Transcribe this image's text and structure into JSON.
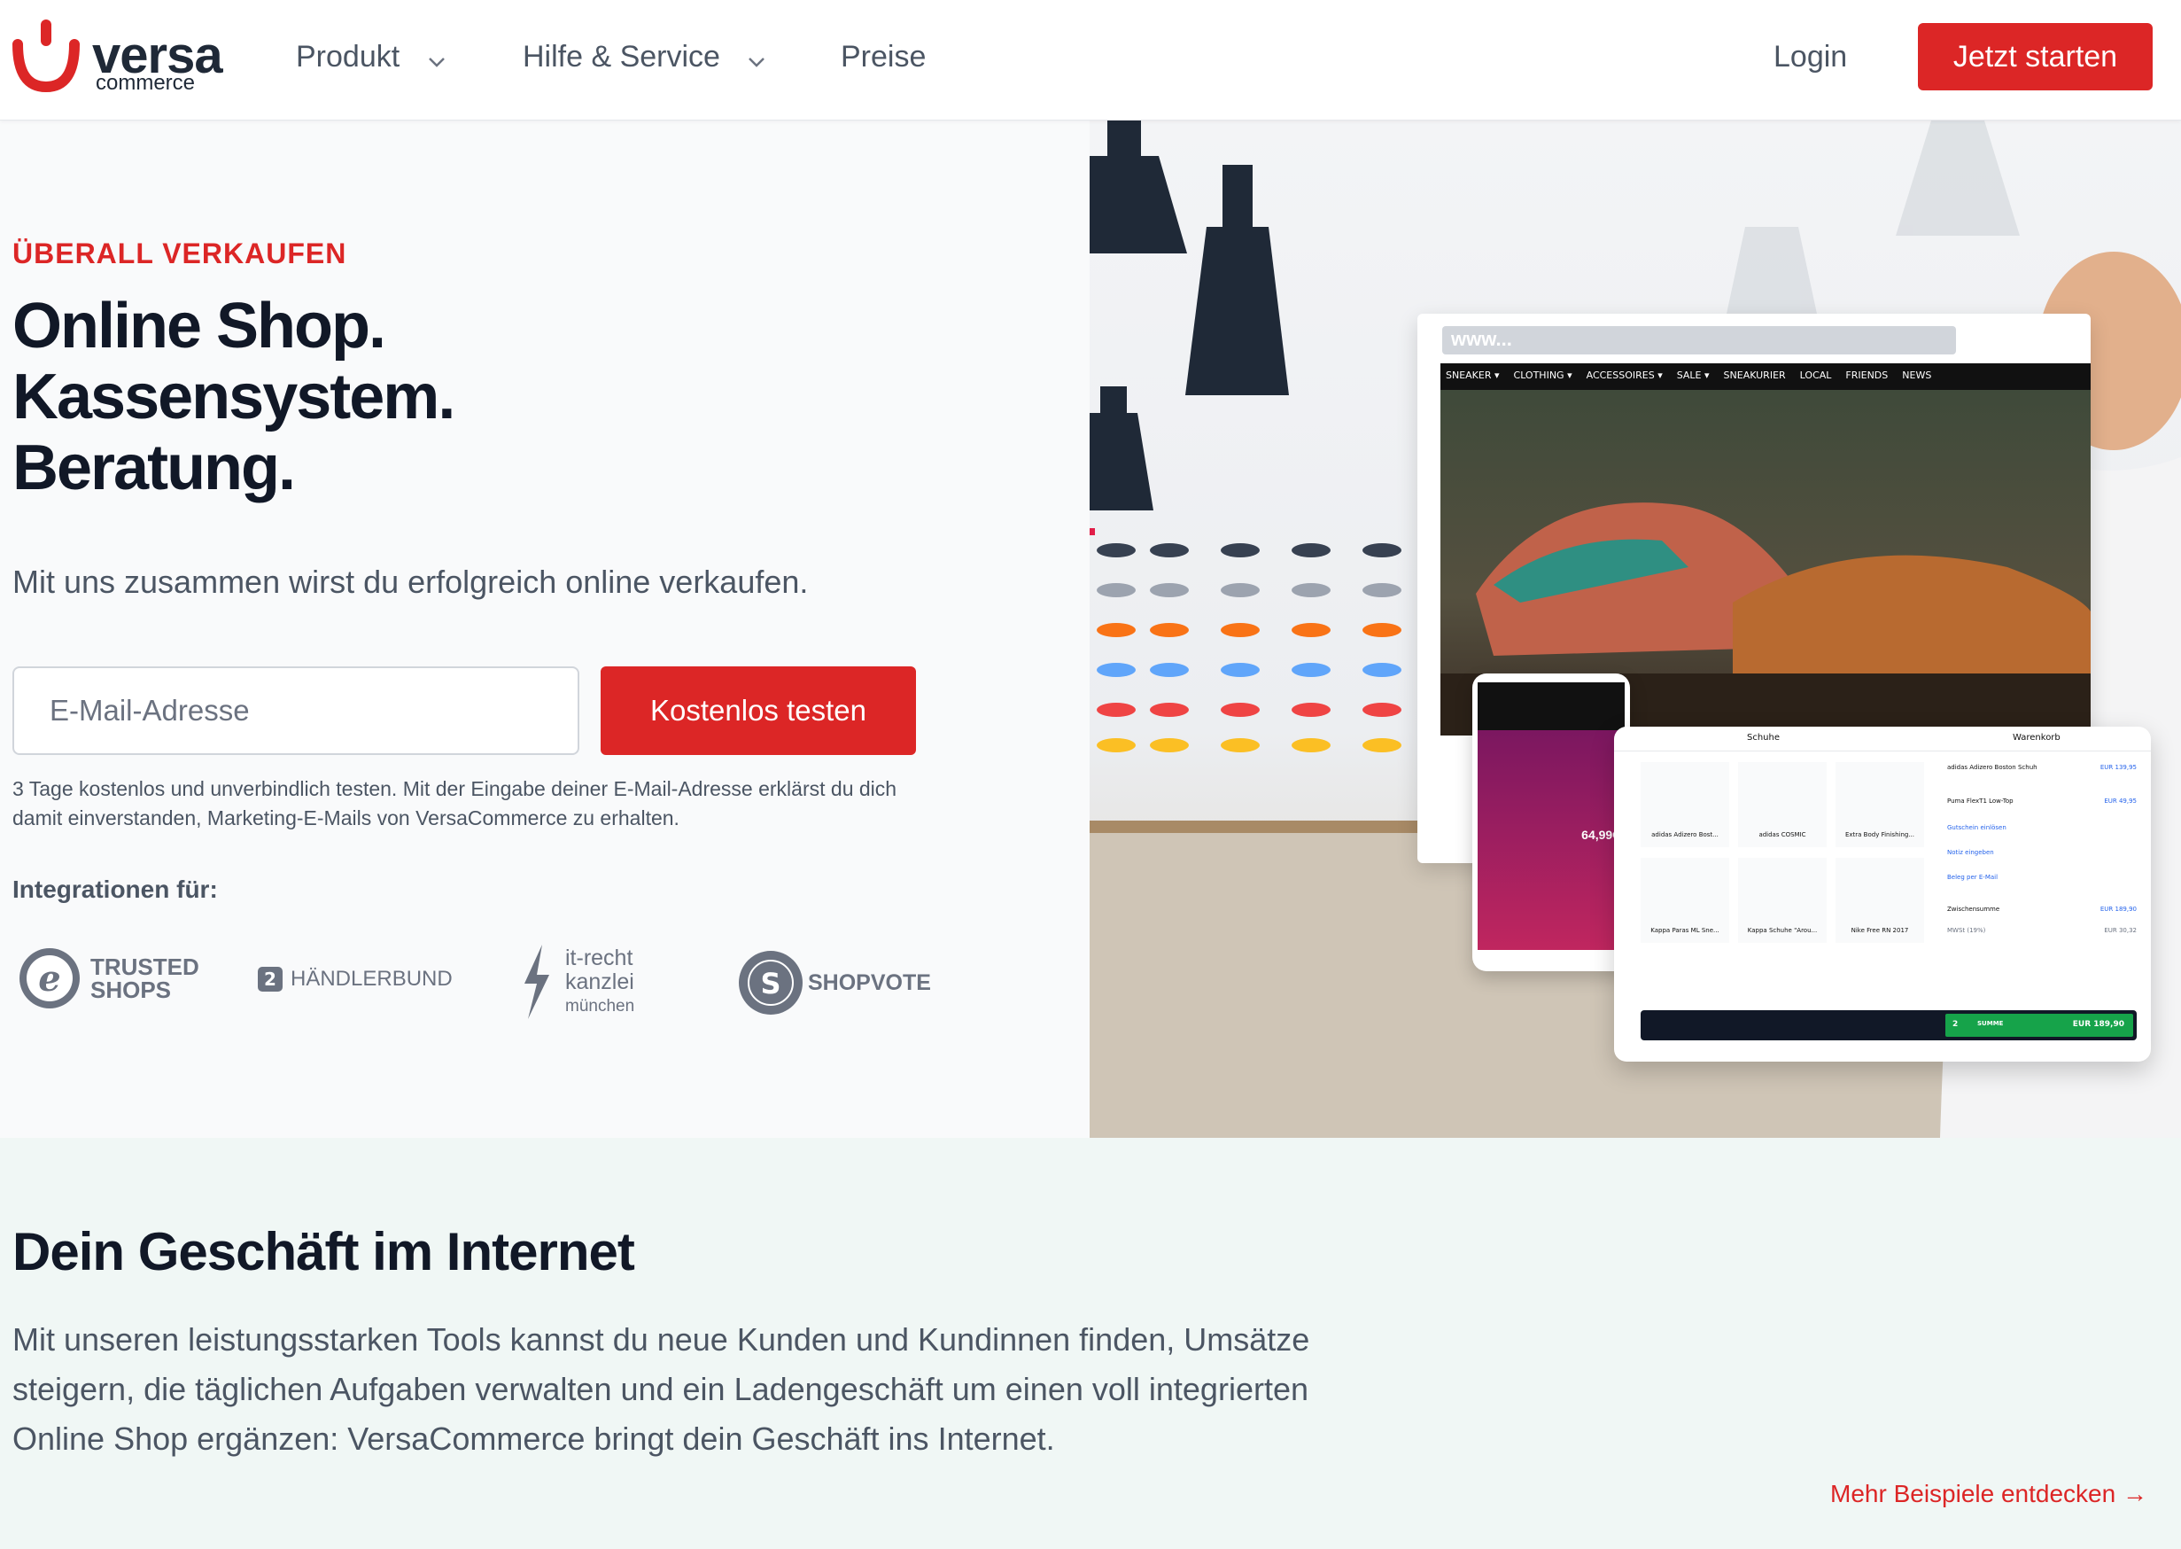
{
  "header": {
    "logo_word": "versa",
    "logo_sub": "commerce",
    "nav": [
      {
        "label": "Produkt",
        "dropdown": true
      },
      {
        "label": "Hilfe & Service",
        "dropdown": true
      },
      {
        "label": "Preise",
        "dropdown": false
      }
    ],
    "login_label": "Login",
    "cta_label": "Jetzt starten"
  },
  "hero": {
    "eyebrow": "ÜBERALL VERKAUFEN",
    "headline_lines": [
      "Online Shop.",
      "Kassensystem.",
      "Beratung."
    ],
    "subline": "Mit uns zusammen wirst du erfolgreich online verkaufen.",
    "email_placeholder": "E-Mail-Adresse",
    "cta_label": "Kostenlos testen",
    "disclaimer": "3 Tage kostenlos und unverbindlich testen. Mit der Eingabe deiner E-Mail-Adresse erklärst du dich damit einverstanden, Marketing-E-Mails von VersaCommerce zu erhalten.",
    "integrations_label": "Integrationen für:",
    "partners": [
      {
        "name": "TRUSTED SHOPS",
        "line1": "TRUSTED",
        "line2": "SHOPS",
        "icon": "trusted-shops-icon"
      },
      {
        "name": "HÄNDLERBUND",
        "icon": "haendlerbund-icon"
      },
      {
        "name": "it-recht kanzlei münchen",
        "line1": "it-recht",
        "line2": "kanzlei",
        "line3": "münchen",
        "icon": "lightning-icon"
      },
      {
        "name": "SHOPVOTE",
        "icon": "shopvote-icon"
      }
    ]
  },
  "mockup": {
    "browser_url": "www...",
    "shop_nav": [
      "SNEAKER ▾",
      "CLOTHING ▾",
      "ACCESSOIRES ▾",
      "SALE ▾",
      "SNEAKURIER",
      "LOCAL",
      "FRIENDS",
      "NEWS"
    ],
    "phone_price": "64,99€",
    "pos_category": "Schuhe",
    "pos_cart_title": "Warenkorb",
    "pos_products": [
      "adidas Adizero Bost...",
      "adidas COSMIC",
      "Extra Body Finishing...",
      "Kappa Paras ML Sne...",
      "Kappa Schuhe \"Arou...",
      "Nike Free RN 2017"
    ],
    "cart_items": [
      {
        "name": "adidas Adizero Boston Schuh",
        "price": "EUR 139,95"
      },
      {
        "name": "Puma FlexT1 Low-Top",
        "price": "EUR 49,95"
      }
    ],
    "cart_links": [
      "Gutschein einlösen",
      "Notiz eingeben",
      "Beleg per E-Mail"
    ],
    "subtotal_label": "Zwischensumme",
    "subtotal_value": "EUR 189,90",
    "tax_label": "MWSt (19%)",
    "tax_value": "EUR 30,32",
    "footer_count": "2",
    "footer_sum_label": "SUMME",
    "footer_sum_value": "EUR 189,90",
    "colors": {
      "pos_green": "#16a34a",
      "pos_dark": "#111827"
    }
  },
  "section2": {
    "title": "Dein Geschäft im Internet",
    "text": "Mit unseren leistungsstarken Tools kannst du neue Kunden und Kundinnen finden, Umsätze steigern, die täglichen Aufgaben verwalten und ein Ladengeschäft um einen voll integrierten Online Shop ergänzen: VersaCommerce bringt dein Geschäft ins Internet.",
    "link_label": "Mehr Beispiele entdecken →"
  },
  "colors": {
    "brand_red": "#dc2626",
    "heading": "#111827",
    "body_text": "#4b5563",
    "section_bg": "#f0f7f5"
  }
}
